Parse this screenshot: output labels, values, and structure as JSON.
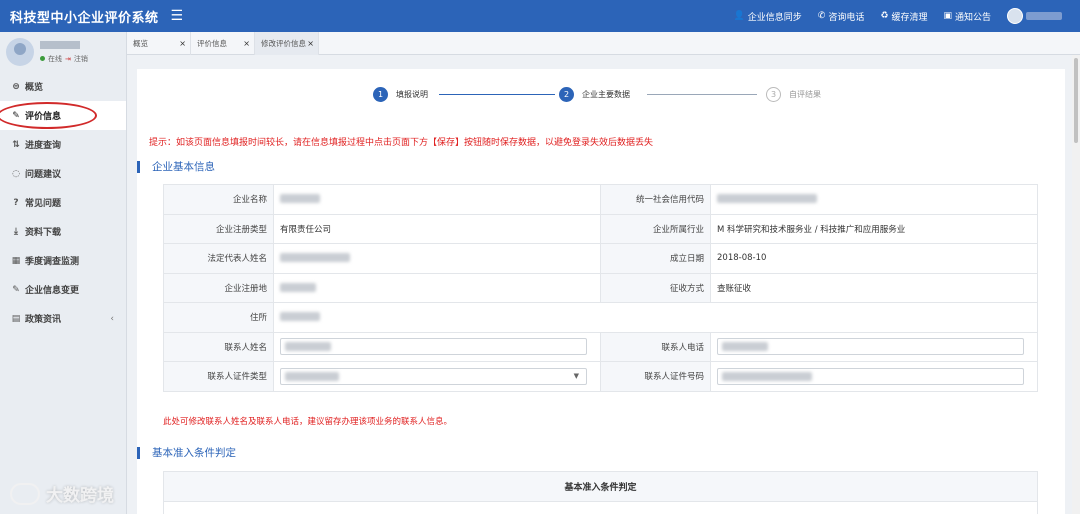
{
  "header": {
    "title": "科技型中小企业评价系统",
    "actions": [
      {
        "icon": "user-icon",
        "label": "企业信息同步"
      },
      {
        "icon": "phone-icon",
        "label": "咨询电话"
      },
      {
        "icon": "recycle-icon",
        "label": "缓存清理"
      },
      {
        "icon": "announcement-icon",
        "label": "通知公告"
      }
    ]
  },
  "sidebar": {
    "status_online": "在线",
    "logout": "注销",
    "items": [
      {
        "icon": "overview-icon",
        "label": "概览"
      },
      {
        "icon": "edit-icon",
        "label": "评价信息"
      },
      {
        "icon": "progress-icon",
        "label": "进度查询"
      },
      {
        "icon": "chat-icon",
        "label": "问题建议"
      },
      {
        "icon": "question-icon",
        "label": "常见问题"
      },
      {
        "icon": "download-icon",
        "label": "资料下载"
      },
      {
        "icon": "calendar-icon",
        "label": "季度调查监测"
      },
      {
        "icon": "edit-icon",
        "label": "企业信息变更"
      },
      {
        "icon": "newspaper-icon",
        "label": "政策资讯"
      }
    ]
  },
  "tabs": [
    {
      "label": "概览"
    },
    {
      "label": "评价信息"
    },
    {
      "label": "修改评价信息"
    }
  ],
  "stepper": [
    {
      "num": "1",
      "label": "填报说明"
    },
    {
      "num": "2",
      "label": "企业主要数据"
    },
    {
      "num": "3",
      "label": "自评结果"
    }
  ],
  "hint": "提示：如该页面信息填报时间较长，请在信息填报过程中点击页面下方【保存】按钮随时保存数据，以避免登录失效后数据丢失",
  "basic_info": {
    "title": "企业基本信息",
    "labels": {
      "company_name": "企业名称",
      "credit_code": "统一社会信用代码",
      "reg_type": "企业注册类型",
      "industry": "企业所属行业",
      "legal_rep": "法定代表人姓名",
      "founded": "成立日期",
      "reg_place": "企业注册地",
      "tax_method": "征收方式",
      "address": "住所",
      "contact_name": "联系人姓名",
      "contact_phone": "联系人电话",
      "contact_id_type": "联系人证件类型",
      "contact_id_no": "联系人证件号码"
    },
    "values": {
      "reg_type": "有限责任公司",
      "industry": "M 科学研究和技术服务业 / 科技推广和应用服务业",
      "founded": "2018-08-10",
      "tax_method": "查账征收"
    }
  },
  "note": "此处可修改联系人姓名及联系人电话，建议留存办理该项业务的联系人信息。",
  "criteria": {
    "title": "基本准入条件判定",
    "table_header": "基本准入条件判定"
  },
  "watermark": "大数跨境"
}
